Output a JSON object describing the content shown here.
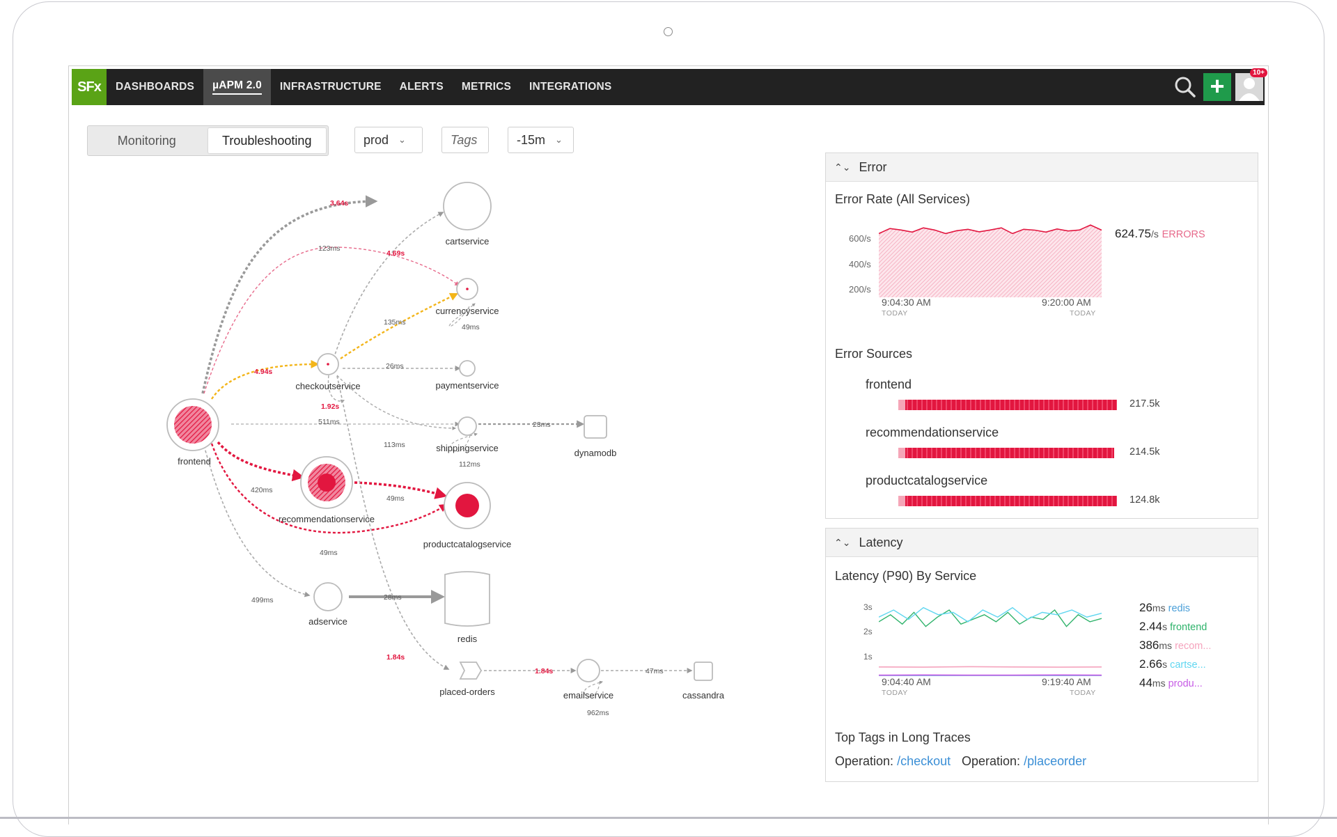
{
  "nav": {
    "logo": "SFx",
    "items": [
      "DASHBOARDS",
      "µAPM 2.0",
      "INFRASTRUCTURE",
      "ALERTS",
      "METRICS",
      "INTEGRATIONS"
    ],
    "active": "µAPM 2.0",
    "notification_badge": "10+"
  },
  "toolbar": {
    "mode_tabs": [
      "Monitoring",
      "Troubleshooting"
    ],
    "selected_mode": "Troubleshooting",
    "environment": "prod",
    "tags_placeholder": "Tags",
    "time_range": "-15m"
  },
  "service_map": {
    "nodes": [
      "cartservice",
      "currencyservice",
      "checkoutservice",
      "paymentservice",
      "frontend",
      "shippingservice",
      "dynamodb",
      "recommendationservice",
      "productcatalogservice",
      "adservice",
      "redis",
      "placed-orders",
      "emailservice",
      "cassandra"
    ],
    "edge_labels": {
      "frontend_cart": "3.64s",
      "frontend_currency": "123ms",
      "currency_err": "4.69s",
      "checkout_currency": "135ms",
      "currency_self": "49ms",
      "frontend_checkout": "4.94s",
      "checkout_payment": "26ms",
      "checkout_shipping_err": "1.92s",
      "frontend_shipping": "511ms",
      "checkout_shipping": "113ms",
      "shipping_self": "112ms",
      "shipping_dynamo": "23ms",
      "frontend_reco": "420ms",
      "reco_product": "49ms",
      "frontend_product": "49ms",
      "frontend_ad": "499ms",
      "ad_redis": "28ms",
      "checkout_placed": "1.84s",
      "placed_email": "1.84s",
      "email_cassandra": "47ms",
      "email_self": "962ms"
    }
  },
  "error_panel": {
    "title": "Error",
    "chart_title": "Error Rate (All Services)",
    "y_ticks": [
      "600/s",
      "400/s",
      "200/s"
    ],
    "x_start": "9:04:30 AM",
    "x_end": "9:20:00 AM",
    "x_sub": "TODAY",
    "current_value": "624.75",
    "current_unit": "/s",
    "current_label": "ERRORS",
    "sources_title": "Error Sources",
    "sources": [
      {
        "name": "frontend",
        "value": "217.5k"
      },
      {
        "name": "recommendationservice",
        "value": "214.5k"
      },
      {
        "name": "productcatalogservice",
        "value": "124.8k"
      }
    ],
    "accent": "#e2163f"
  },
  "latency_panel": {
    "title": "Latency",
    "chart_title": "Latency (P90) By Service",
    "y_ticks": [
      "3s",
      "2s",
      "1s"
    ],
    "x_start": "9:04:40 AM",
    "x_end": "9:19:40 AM",
    "x_sub": "TODAY",
    "legend": [
      {
        "value": "26",
        "unit": "ms",
        "name": "redis",
        "color": "#4a9fd8"
      },
      {
        "value": "2.44",
        "unit": "s",
        "name": "frontend",
        "color": "#2fb36b"
      },
      {
        "value": "386",
        "unit": "ms",
        "name": "recom...",
        "color": "#f5a3bd"
      },
      {
        "value": "2.66",
        "unit": "s",
        "name": "cartse...",
        "color": "#5fd6f0"
      },
      {
        "value": "44",
        "unit": "ms",
        "name": "produ...",
        "color": "#c75ce6"
      }
    ],
    "tags_title": "Top Tags in Long Traces",
    "tags": [
      {
        "key": "Operation:",
        "value": "/checkout"
      },
      {
        "key": "Operation:",
        "value": "/placeorder"
      }
    ]
  },
  "chart_data": [
    {
      "type": "area",
      "title": "Error Rate (All Services)",
      "x": [
        "9:04:30 AM",
        "9:20:00 AM"
      ],
      "ylim": [
        150,
        700
      ],
      "y_ticks": [
        200,
        400,
        600
      ],
      "series": [
        {
          "values": [
            600,
            635,
            625,
            610,
            640,
            625,
            600,
            620,
            630,
            612,
            625,
            640,
            600,
            630,
            624,
            610,
            632,
            618,
            625,
            660,
            624
          ]
        }
      ]
    },
    {
      "type": "line",
      "title": "Latency (P90) By Service",
      "x": [
        "9:04:40 AM",
        "9:19:40 AM"
      ],
      "ylim": [
        0,
        3.3
      ],
      "y_ticks": [
        1,
        2,
        3
      ],
      "series": [
        {
          "name": "redis",
          "values": [
            0.03,
            0.03,
            0.03,
            0.03,
            0.03,
            0.03
          ]
        },
        {
          "name": "frontend",
          "values": [
            2.3,
            2.6,
            2.2,
            2.7,
            2.1,
            2.5,
            2.8,
            2.2,
            2.4,
            2.6,
            2.3,
            2.7,
            2.2,
            2.5,
            2.4,
            2.8,
            2.1,
            2.6,
            2.3,
            2.44
          ]
        },
        {
          "name": "recom...",
          "values": [
            0.39,
            0.38,
            0.4,
            0.39,
            0.38,
            0.39
          ]
        },
        {
          "name": "cartse...",
          "values": [
            2.5,
            2.8,
            2.4,
            2.9,
            2.6,
            2.7,
            2.3,
            2.8,
            2.5,
            2.9,
            2.4,
            2.7,
            2.6,
            2.8,
            2.5,
            2.66
          ]
        },
        {
          "name": "produ...",
          "values": [
            0.04,
            0.05,
            0.04,
            0.04,
            0.05,
            0.04
          ]
        }
      ]
    }
  ]
}
